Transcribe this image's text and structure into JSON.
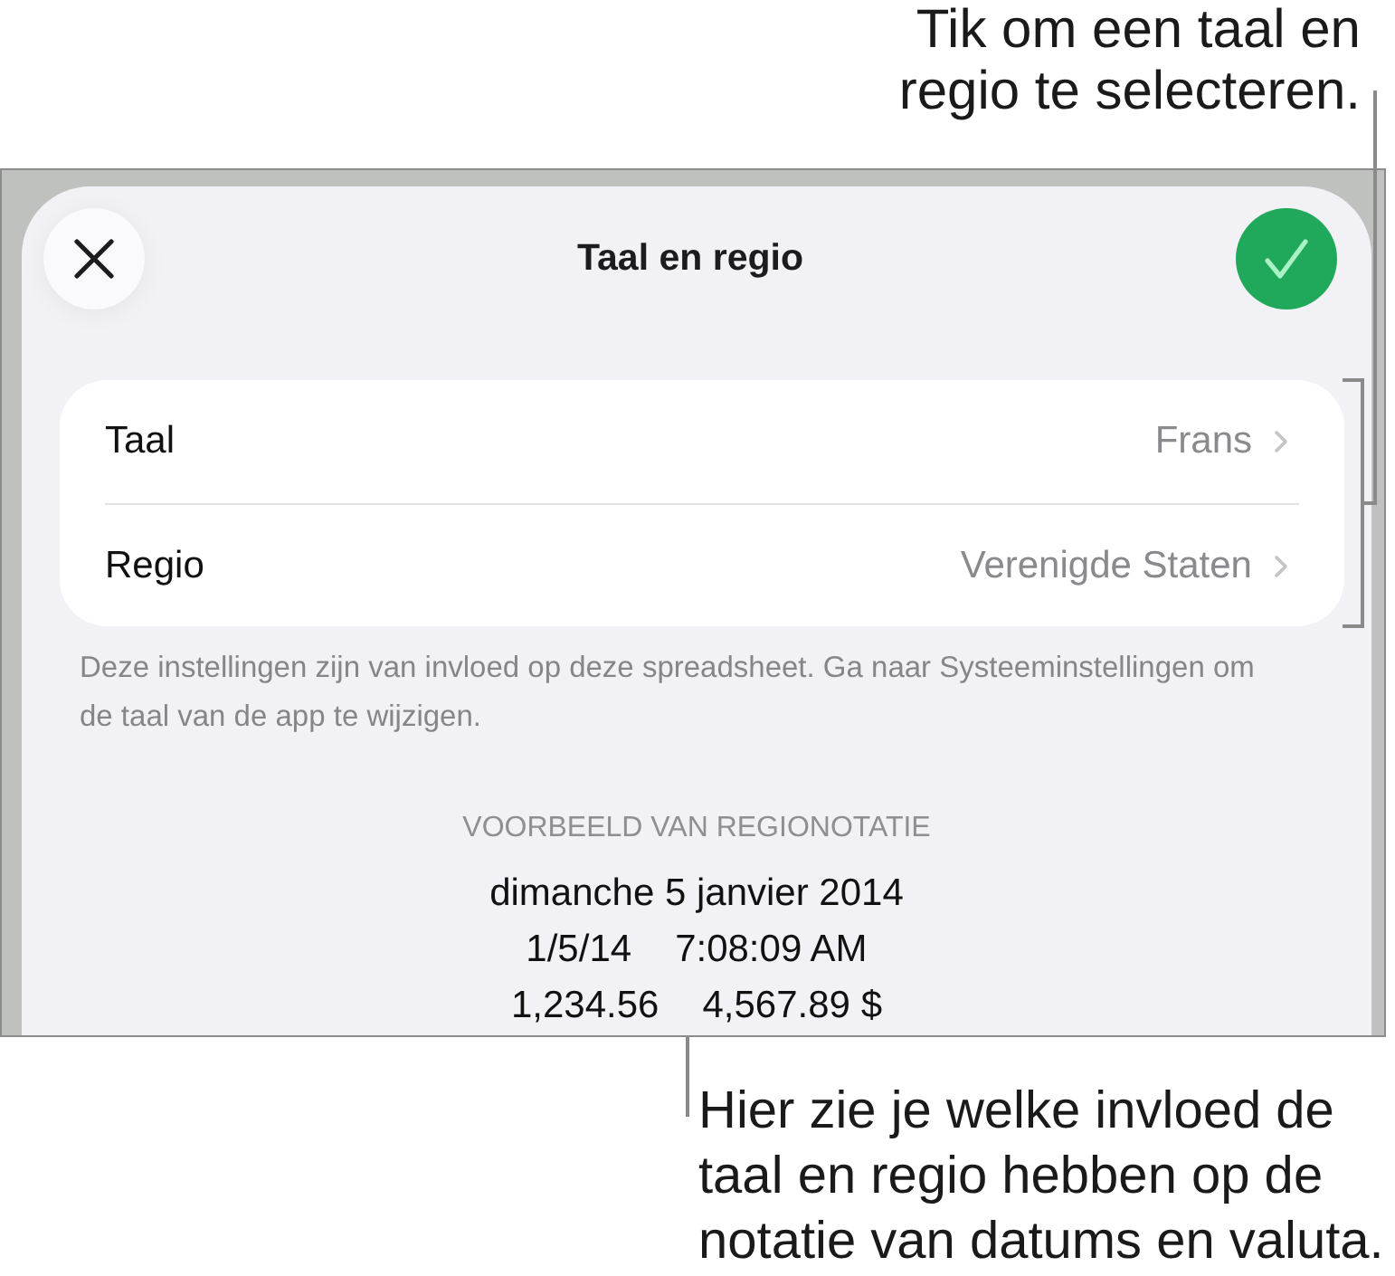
{
  "callout_top": {
    "text": "Tik om een taal en regio te selecteren."
  },
  "sheet": {
    "title": "Taal en regio"
  },
  "settings": [
    {
      "label": "Taal",
      "value": "Frans"
    },
    {
      "label": "Regio",
      "value": "Verenigde Staten"
    }
  ],
  "note": "Deze instellingen zijn van invloed op deze spreadsheet. Ga naar Systeeminstellingen om de taal van de app te wijzigen.",
  "preview": {
    "heading": "VOORBEELD VAN REGIONOTATIE",
    "long_date": "dimanche 5 janvier 2014",
    "short_date": "1/5/14",
    "time": "7:08:09 AM",
    "number": "1,234.56",
    "currency": "4,567.89 $"
  },
  "callout_bottom": {
    "text": "Hier zie je welke invloed de taal en regio hebben op de notatie van datums en valuta."
  }
}
